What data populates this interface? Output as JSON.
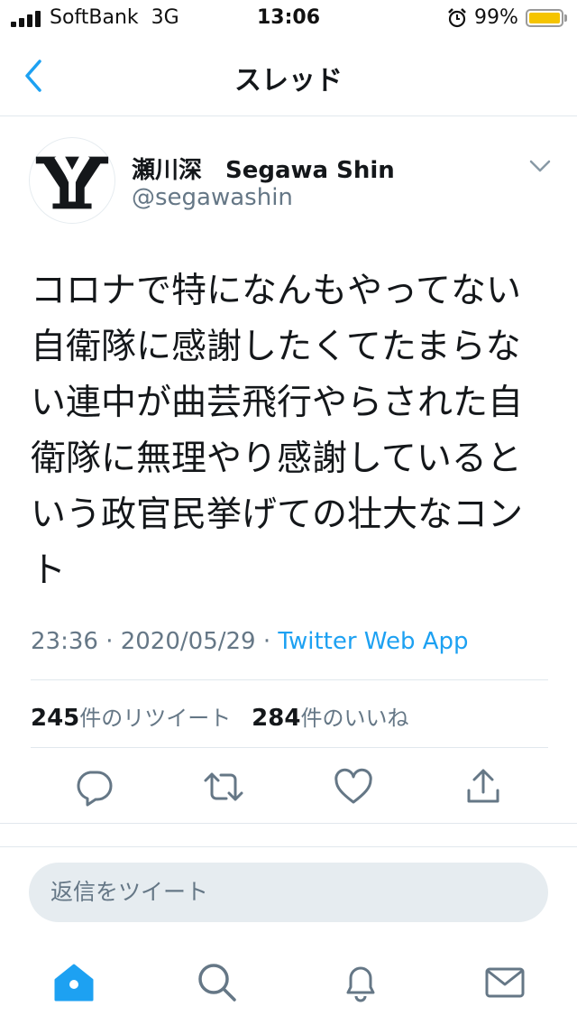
{
  "status_bar": {
    "carrier": "SoftBank  3G",
    "time": "13:06",
    "battery": "99%",
    "battery_level": 0.99
  },
  "nav": {
    "title": "スレッド",
    "back_icon": "chevron-left-icon"
  },
  "tweet": {
    "display_name": "瀬川深　Segawa Shin",
    "handle": "@segawashin",
    "text": "コロナで特になんもやってない\n自衛隊に感謝したくてたまらな\nい連中が曲芸飛行やらされた自\n衛隊に無理やり感謝していると\nいう政官民挙げての壮大なコン\nト",
    "timestamp": "23:36 · 2020/05/29 · ",
    "source": "Twitter Web App",
    "retweet_count": "245",
    "retweet_label": "件のリツイート",
    "like_count": "284",
    "like_label": "件のいいね"
  },
  "actions": [
    "reply-icon",
    "retweet-icon",
    "like-icon",
    "share-icon"
  ],
  "reply": {
    "placeholder": "返信をツイート"
  },
  "tabs": [
    "home-icon",
    "search-icon",
    "notifications-icon",
    "messages-icon"
  ],
  "colors": {
    "accent": "#1da1f2",
    "secondary_text": "#657786",
    "icon": "#657786",
    "battery": "#f5c400"
  }
}
